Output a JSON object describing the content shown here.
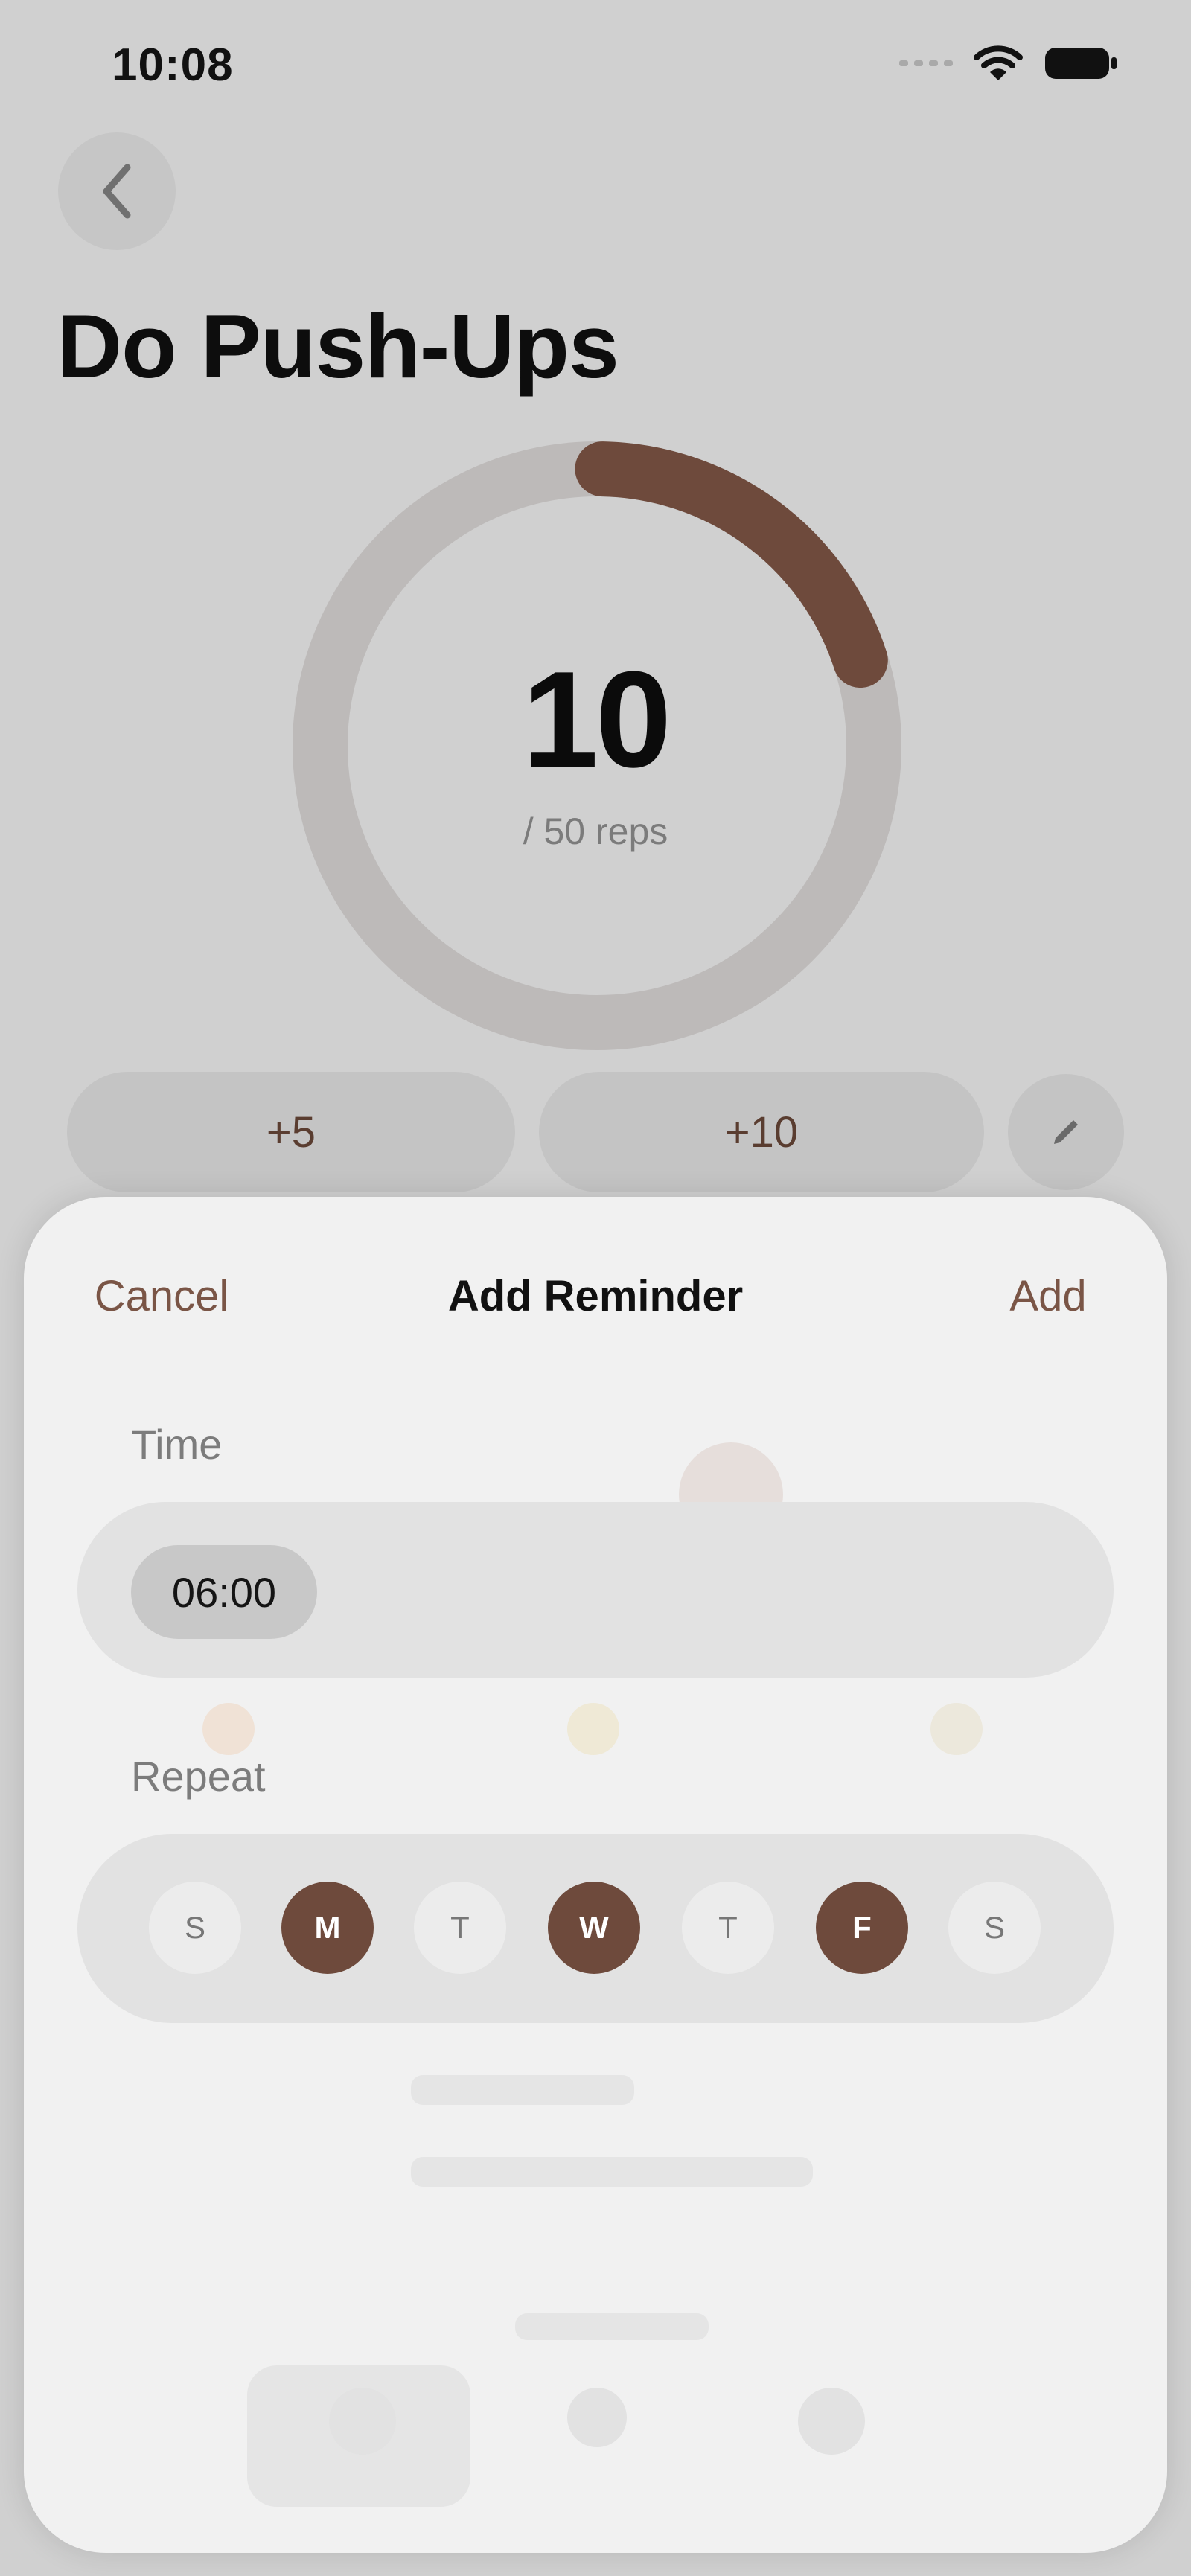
{
  "status_bar": {
    "time": "10:08",
    "icons": [
      "signal-icon",
      "wifi-icon",
      "battery-icon"
    ]
  },
  "header": {
    "title": "Do Push-Ups",
    "back_icon": "chevron-left-icon"
  },
  "progress": {
    "count": "10",
    "goal_label": "/ 50 reps",
    "fraction": 0.2,
    "color": "#6e4a3c"
  },
  "actions": {
    "plus5": "+5",
    "plus10": "+10",
    "edit_icon": "pencil-icon"
  },
  "sheet": {
    "cancel": "Cancel",
    "title": "Add Reminder",
    "add": "Add",
    "time_label": "Time",
    "time_value": "06:00",
    "repeat_label": "Repeat",
    "days": [
      {
        "label": "S",
        "selected": false
      },
      {
        "label": "M",
        "selected": true
      },
      {
        "label": "T",
        "selected": false
      },
      {
        "label": "W",
        "selected": true
      },
      {
        "label": "T",
        "selected": false
      },
      {
        "label": "F",
        "selected": true
      },
      {
        "label": "S",
        "selected": false
      }
    ]
  },
  "colors": {
    "accent": "#6e4a3c",
    "accent_text": "#7a5546",
    "background": "#d0d0d0",
    "sheet": "#f1f1f1"
  }
}
